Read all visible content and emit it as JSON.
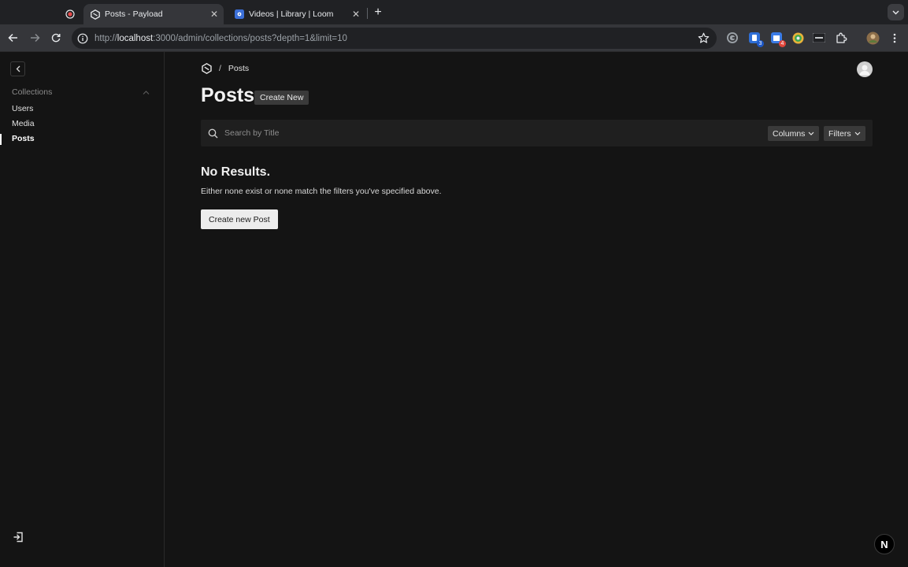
{
  "browser": {
    "tabs": [
      {
        "title": "",
        "favicon": "record-icon",
        "active": false
      },
      {
        "title": "Posts - Payload",
        "favicon": "payload-logo-icon",
        "active": true
      },
      {
        "title": "Videos | Library | Loom",
        "favicon": "loom-icon",
        "active": false
      }
    ],
    "url_prefix": "http://",
    "url_host": "localhost",
    "url_rest": ":3000/admin/collections/posts?depth=1&limit=10",
    "extensions": [
      {
        "name": "grammarly-icon"
      },
      {
        "name": "extension-blue-icon",
        "badge": "3"
      },
      {
        "name": "extension-calendar-icon",
        "badge": "4"
      },
      {
        "name": "extension-green-icon"
      },
      {
        "name": "extension-dark-icon"
      },
      {
        "name": "puzzle-icon"
      },
      {
        "name": "profile-avatar-icon"
      }
    ]
  },
  "sidebar": {
    "group_label": "Collections",
    "items": [
      {
        "label": "Users",
        "active": false
      },
      {
        "label": "Media",
        "active": false
      },
      {
        "label": "Posts",
        "active": true
      }
    ]
  },
  "main": {
    "breadcrumb": {
      "separator": "/",
      "current": "Posts"
    },
    "title": "Posts",
    "create_new_label": "Create New",
    "search_placeholder": "Search by Title",
    "columns_label": "Columns",
    "filters_label": "Filters",
    "no_results_title": "No Results.",
    "no_results_text": "Either none exist or none match the filters you've specified above.",
    "create_post_label": "Create new Post"
  },
  "dev_badge": "N",
  "colors": {
    "background": "#141414",
    "panel": "#1f1f1f",
    "button_dark": "#3a3a3a",
    "button_light": "#ececec",
    "text": "#e6e6e6"
  }
}
